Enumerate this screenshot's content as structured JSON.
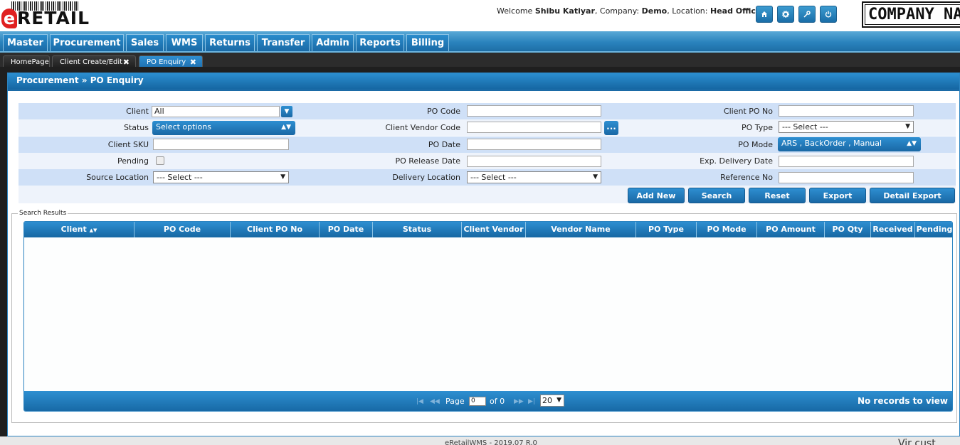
{
  "header": {
    "logo_text": "RETAIL",
    "logo_e": "e",
    "welcome_prefix": "Welcome",
    "user": "Shibu Katiyar",
    "company_label": ", Company:",
    "company": "Demo",
    "location_label": ", Location:",
    "location": "Head Office",
    "company_logo_text": "COMPANY NAM",
    "icons": [
      "home-icon",
      "gear-icon",
      "key-icon",
      "power-icon"
    ]
  },
  "menu": [
    "Master",
    "Procurement",
    "Sales",
    "WMS",
    "Returns",
    "Transfer",
    "Admin",
    "Reports",
    "Billing"
  ],
  "tabs": [
    {
      "label": "HomePage",
      "closable": false
    },
    {
      "label": "Client Create/Edit",
      "closable": true
    },
    {
      "label": "PO Enquiry",
      "closable": true,
      "active": true
    }
  ],
  "panel_title": "Procurement » PO Enquiry",
  "form": {
    "client_label": "Client",
    "client_value": "All",
    "po_code_label": "PO Code",
    "client_po_no_label": "Client PO No",
    "status_label": "Status",
    "status_value": "Select options",
    "client_vendor_code_label": "Client Vendor Code",
    "lookup_label": "...",
    "po_type_label": "PO Type",
    "po_type_value": "--- Select ---",
    "client_sku_label": "Client SKU",
    "po_date_label": "PO Date",
    "po_mode_label": "PO Mode",
    "po_mode_value": "ARS , BackOrder , Manual",
    "pending_label": "Pending",
    "po_release_date_label": "PO Release Date",
    "exp_delivery_date_label": "Exp. Delivery Date",
    "source_location_label": "Source Location",
    "source_location_value": "--- Select ---",
    "delivery_location_label": "Delivery Location",
    "delivery_location_value": "--- Select ---",
    "reference_no_label": "Reference No"
  },
  "actions": [
    "Add New",
    "Search",
    "Reset",
    "Export",
    "Detail Export"
  ],
  "results": {
    "legend": "Search Results",
    "columns": [
      "Client",
      "PO Code",
      "Client PO No",
      "PO Date",
      "Status",
      "Client Vendor",
      "Vendor Name",
      "PO Type",
      "PO Mode",
      "PO Amount",
      "PO Qty",
      "Received",
      "Pending"
    ],
    "sort_indicator": "▲▼",
    "pager": {
      "page_label": "Page",
      "page_value": "0",
      "of_label": "of 0",
      "rows_per_page": "20",
      "status": "No records to view"
    }
  },
  "footer": {
    "version": "eRetailWMS - 2019.07 R.0",
    "partial_text": "Vir cust..."
  }
}
